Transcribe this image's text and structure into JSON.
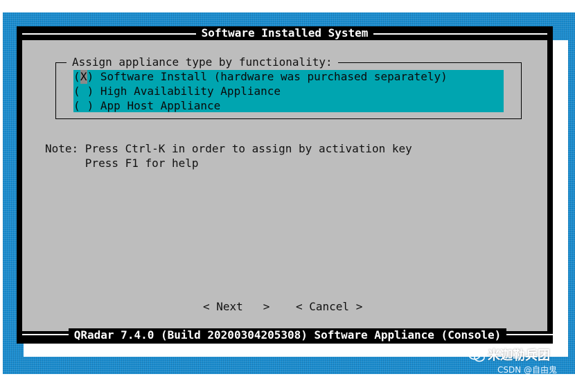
{
  "dialog": {
    "title": "Software Installed System",
    "group_label": "Assign appliance type by functionality:",
    "options": [
      {
        "mark": "X",
        "label": "Software Install (hardware was purchased separately)",
        "selected": true
      },
      {
        "mark": " ",
        "label": "High Availability Appliance",
        "selected": false
      },
      {
        "mark": " ",
        "label": "App Host Appliance",
        "selected": false
      }
    ],
    "note_line1": "Note: Press Ctrl-K in order to assign by activation key",
    "note_line2": "      Press F1 for help",
    "next_button": "< Next   >",
    "cancel_button": "< Cancel >"
  },
  "status_bar": "QRadar 7.4.0 (Build 20200304205308) Software Appliance (Console)",
  "watermark": {
    "name": "米迦勒兵团",
    "credit": "CSDN @自由鬼"
  },
  "colors": {
    "background": "#1a8ccf",
    "dialog_frame": "#000000",
    "dialog_body": "#bdbdbd",
    "option_highlight": "#00a5b0"
  }
}
